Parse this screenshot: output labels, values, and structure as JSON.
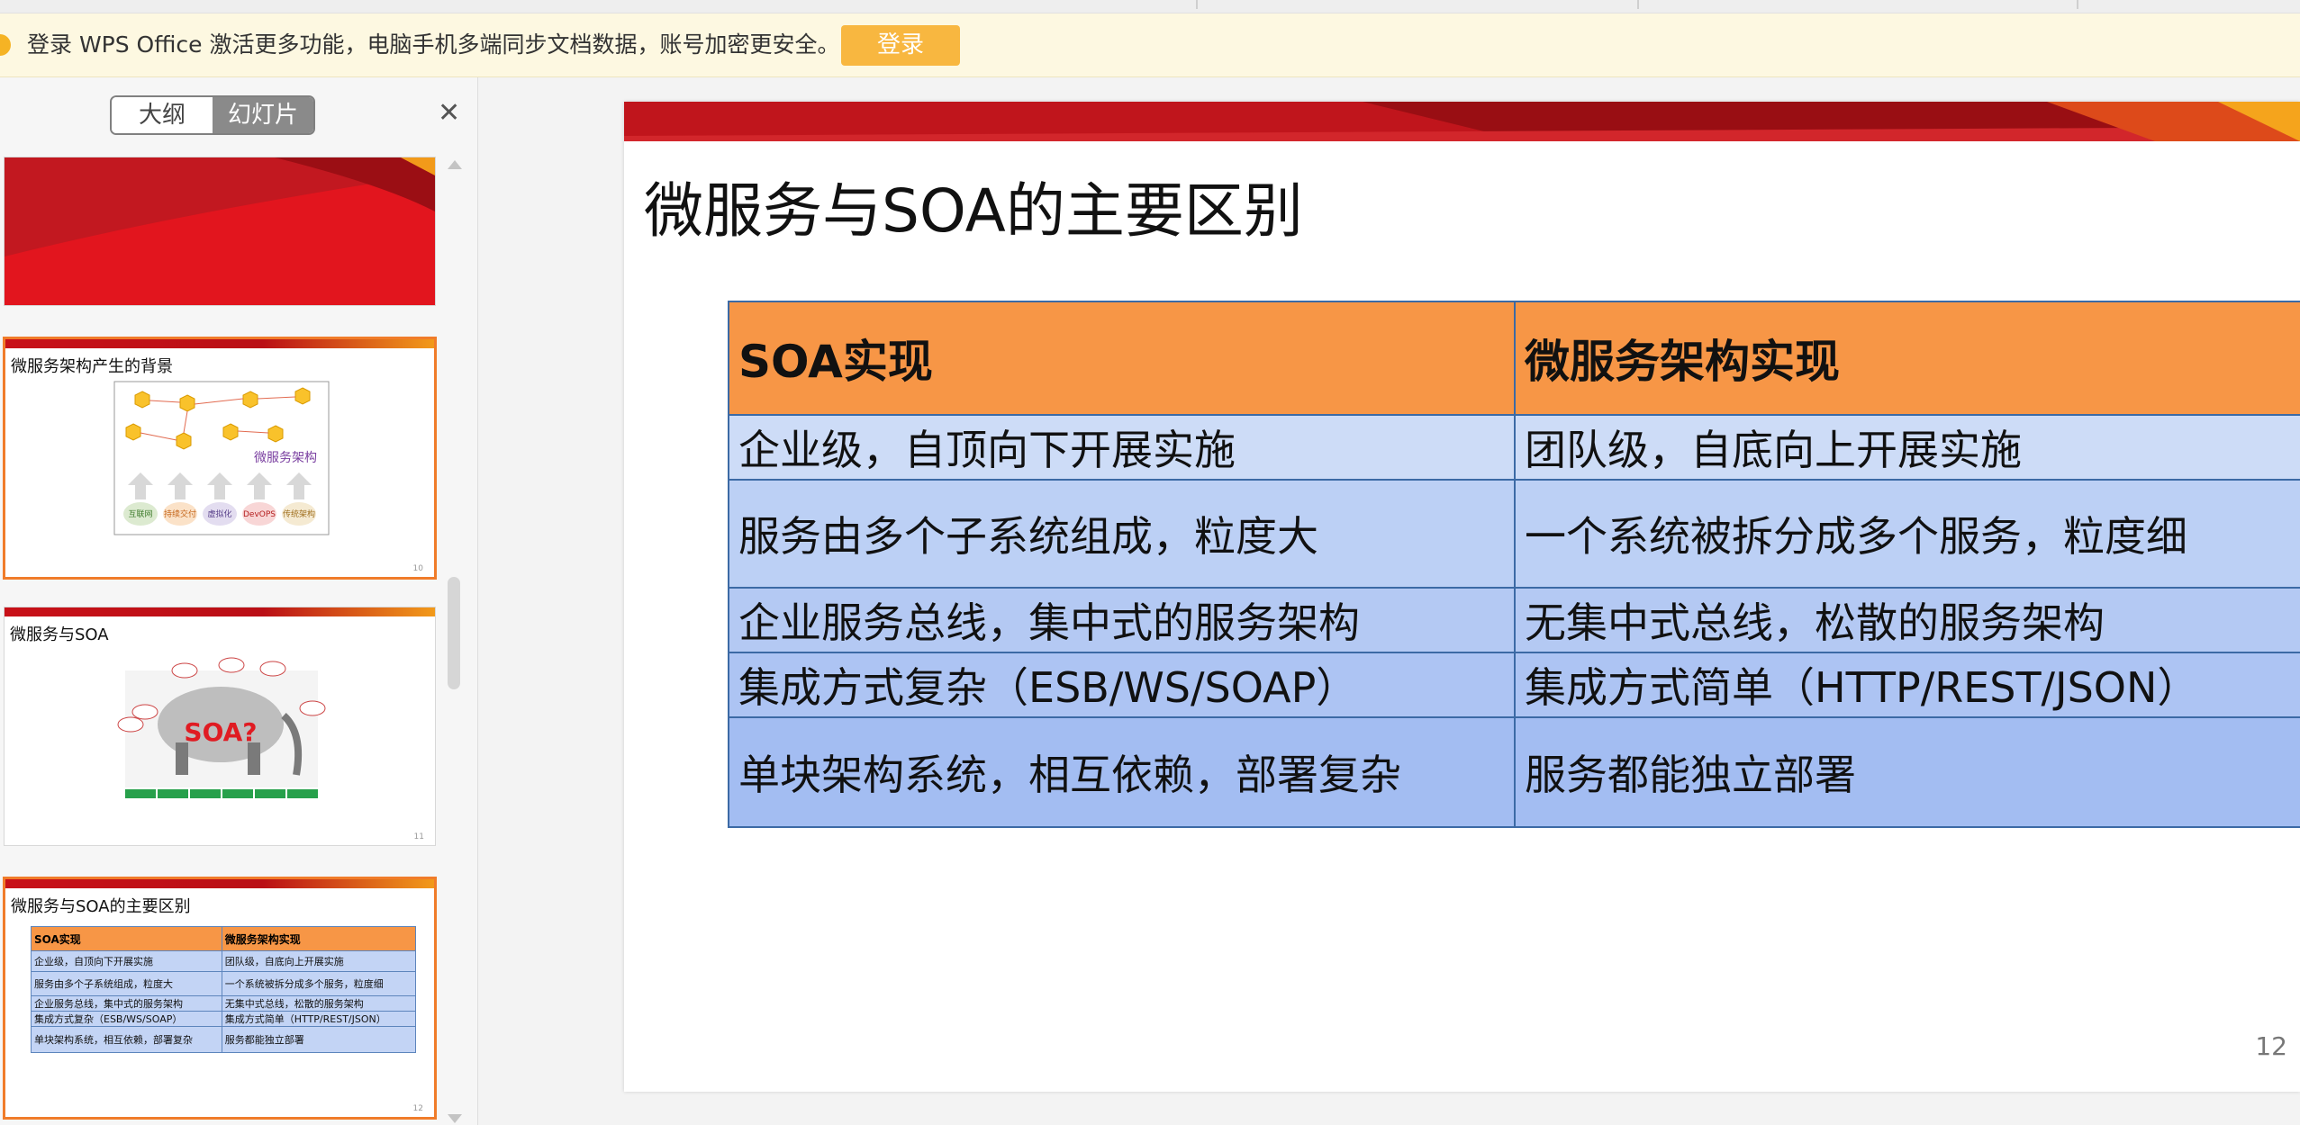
{
  "notice": {
    "text": "登录 WPS Office 激活更多功能，电脑手机多端同步文档数据，账号加密更安全。",
    "login_label": "登录"
  },
  "panel": {
    "tab_outline": "大纲",
    "tab_slides": "幻灯片",
    "active_tab": "幻灯片"
  },
  "thumbs": [
    {
      "title": "",
      "page": ""
    },
    {
      "title": "微服务架构产生的背景",
      "label": "微服务架构",
      "chips": [
        "互联网",
        "持续交付",
        "虚拟化",
        "DevOPS",
        "传统架构"
      ],
      "page": "10"
    },
    {
      "title": "微服务与SOA",
      "page": "11"
    },
    {
      "title": "微服务与SOA的主要区别",
      "page": "12"
    }
  ],
  "slide": {
    "title": "微服务与SOA的主要区别",
    "number": "12",
    "colors": {
      "header": "#f79646",
      "border": "#3c6aa5",
      "band": "#c0151c"
    },
    "table": {
      "headers": [
        "SOA实现",
        "微服务架构实现"
      ],
      "rows": [
        [
          "企业级，自顶向下开展实施",
          "团队级，自底向上开展实施"
        ],
        [
          "服务由多个子系统组成，粒度大",
          "一个系统被拆分成多个服务，粒度细"
        ],
        [
          "企业服务总线，集中式的服务架构",
          "无集中式总线，松散的服务架构"
        ],
        [
          "集成方式复杂（ESB/WS/SOAP）",
          "集成方式简单（HTTP/REST/JSON）"
        ],
        [
          "单块架构系统，相互依赖，部署复杂",
          "服务都能独立部署"
        ]
      ]
    }
  }
}
